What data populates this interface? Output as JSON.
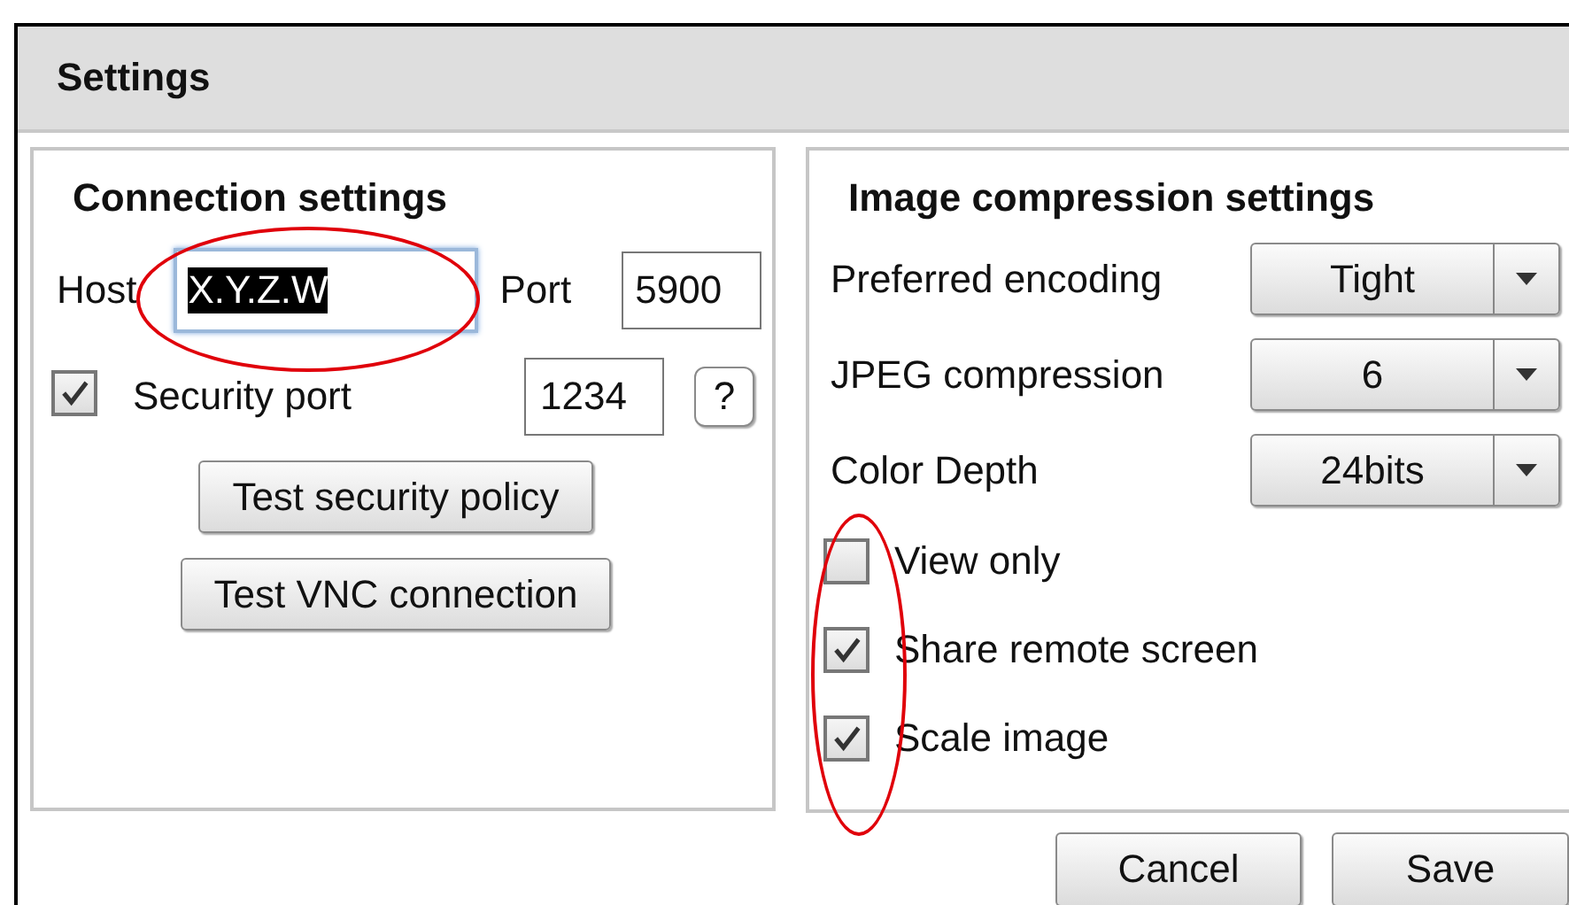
{
  "window": {
    "title": "Settings"
  },
  "connection": {
    "heading": "Connection settings",
    "host": {
      "label": "Host",
      "value": "X.Y.Z.W",
      "text_selected": true,
      "circled": true
    },
    "port": {
      "label": "Port",
      "value": "5900"
    },
    "security": {
      "label": "Security port",
      "checked": true,
      "value": "1234",
      "help": "?"
    },
    "buttons": [
      "Test security policy",
      "Test VNC connection"
    ]
  },
  "compression": {
    "heading": "Image compression settings",
    "selects": [
      {
        "label": "Preferred encoding",
        "value": "Tight"
      },
      {
        "label": "JPEG compression",
        "value": "6"
      },
      {
        "label": "Color Depth",
        "value": "24bits"
      }
    ],
    "options": [
      {
        "label": "View only",
        "checked": false
      },
      {
        "label": "Share remote screen",
        "checked": true
      },
      {
        "label": "Scale image",
        "checked": true
      }
    ],
    "circled": true
  },
  "buttons": [
    "Cancel",
    "Save"
  ]
}
